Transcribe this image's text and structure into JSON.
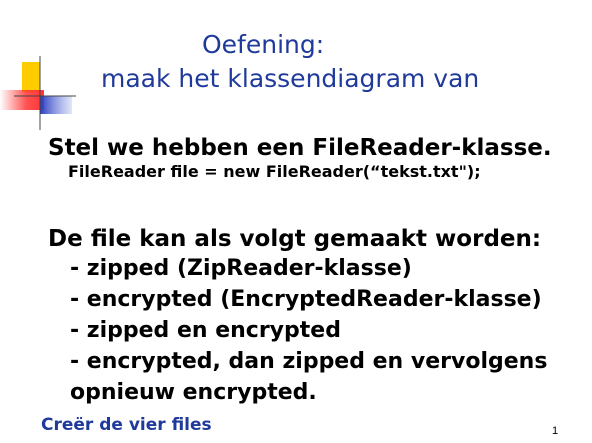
{
  "slide": {
    "title_line1": "Oefening:",
    "title_line2": "maak het klassendiagram van",
    "intro_heading": "Stel we hebben een FileReader-klasse.",
    "code_line": "FileReader file = new FileReader(“tekst.txt\");",
    "list_heading": "De file kan als volgt gemaakt worden:",
    "items": [
      "- zipped (ZipReader-klasse)",
      "- encrypted (EncryptedReader-klasse)",
      "- zipped en encrypted",
      "- encrypted, dan zipped en vervolgens",
      "opnieuw encrypted."
    ],
    "footer": "Creër de vier files",
    "page_number": "1"
  },
  "colors": {
    "title": "#1f3a9a",
    "body_text": "#000000",
    "deco_yellow": "#ffcc00",
    "deco_red": "#ff3333",
    "deco_blue": "#2a3ec0"
  }
}
